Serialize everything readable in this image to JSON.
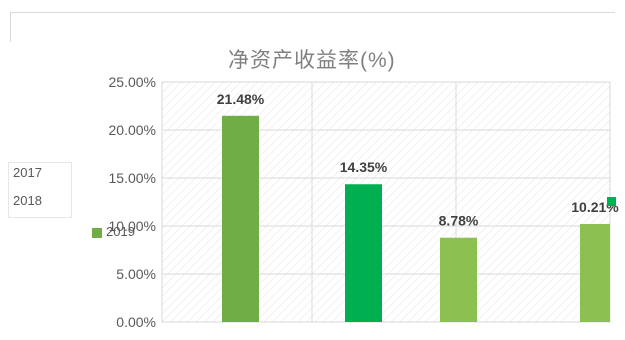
{
  "chart_data": {
    "type": "bar",
    "title": "净资产收益率(%)",
    "xlabel": "",
    "ylabel": "",
    "ylim": [
      0,
      0.25
    ],
    "y_ticks": [
      "0.00%",
      "5.00%",
      "10.00%",
      "15.00%",
      "20.00%",
      "25.00%"
    ],
    "grid": true,
    "legend_placement": "left",
    "series": [
      {
        "name": "2017",
        "color": "#70ad47"
      },
      {
        "name": "2018",
        "color": "#00b050"
      },
      {
        "name": "2019",
        "color": "#8cc152"
      }
    ],
    "bars": [
      {
        "series": "2017",
        "value": 0.2148,
        "label": "21.48%"
      },
      {
        "series": "2018",
        "value": 0.1435,
        "label": "14.35%"
      },
      {
        "series": "2019",
        "value": 0.0878,
        "label": "8.78%"
      },
      {
        "series": "2019",
        "value": 0.1021,
        "label": "10.21%"
      }
    ]
  }
}
